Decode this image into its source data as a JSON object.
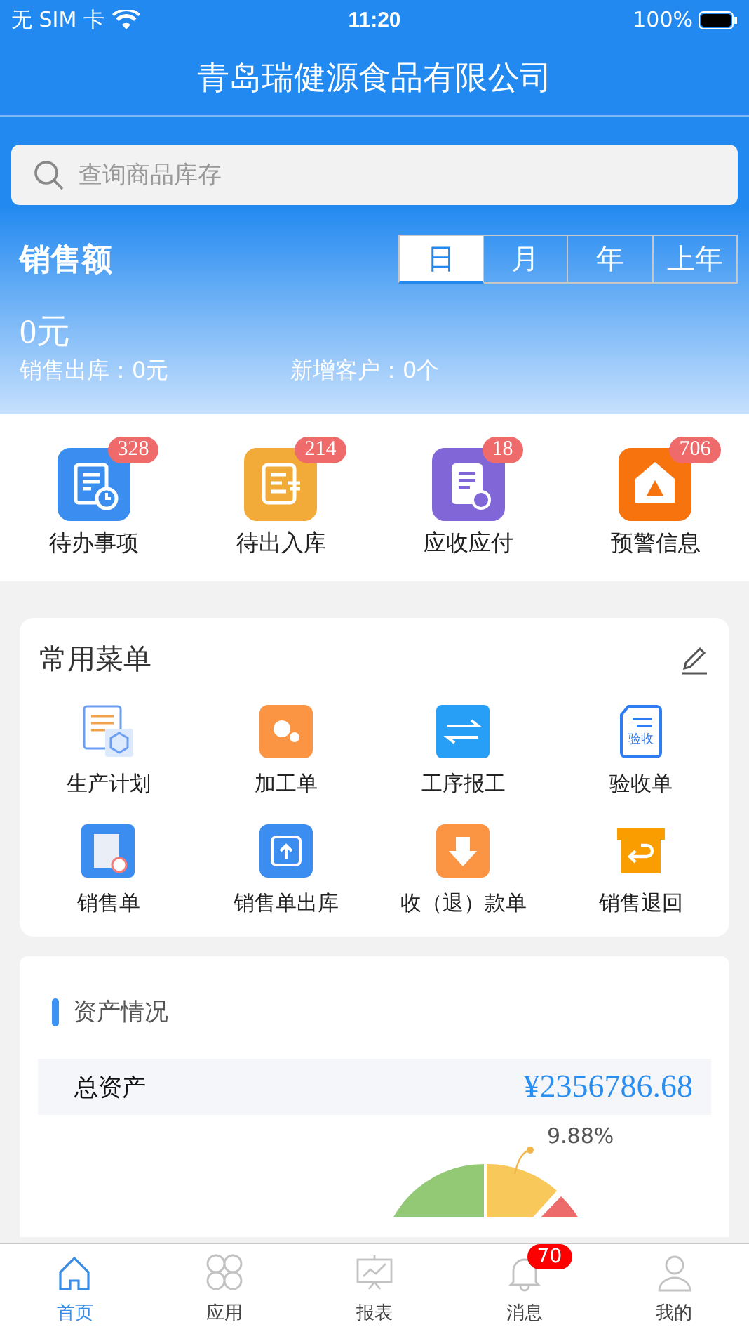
{
  "status_bar": {
    "carrier": "无 SIM 卡",
    "time": "11:20",
    "battery": "100%"
  },
  "header": {
    "title": "青岛瑞健源食品有限公司"
  },
  "search": {
    "placeholder": "查询商品库存"
  },
  "sales": {
    "title": "销售额",
    "periods": [
      {
        "label": "日",
        "selected": true
      },
      {
        "label": "月",
        "selected": false
      },
      {
        "label": "年",
        "selected": false
      },
      {
        "label": "上年",
        "selected": false
      }
    ],
    "amount": "0元",
    "stats": [
      "销售出库：0元",
      "新增客户：0个"
    ]
  },
  "quick_actions": [
    {
      "label": "待办事项",
      "badge": "328"
    },
    {
      "label": "待出入库",
      "badge": "214"
    },
    {
      "label": "应收应付",
      "badge": "18"
    },
    {
      "label": "预警信息",
      "badge": "706"
    }
  ],
  "common_menu": {
    "title": "常用菜单",
    "items": [
      "生产计划",
      "加工单",
      "工序报工",
      "验收单",
      "销售单",
      "销售单出库",
      "收（退）款单",
      "销售退回"
    ],
    "icon_text": "验收"
  },
  "assets": {
    "title": "资产情况",
    "total_label": "总资产",
    "total_value": "¥2356786.68",
    "chart_label": "9.88%"
  },
  "tab_bar": [
    {
      "label": "首页",
      "selected": true
    },
    {
      "label": "应用",
      "selected": false
    },
    {
      "label": "报表",
      "selected": false
    },
    {
      "label": "消息",
      "selected": false,
      "badge": "70"
    },
    {
      "label": "我的",
      "selected": false
    }
  ]
}
